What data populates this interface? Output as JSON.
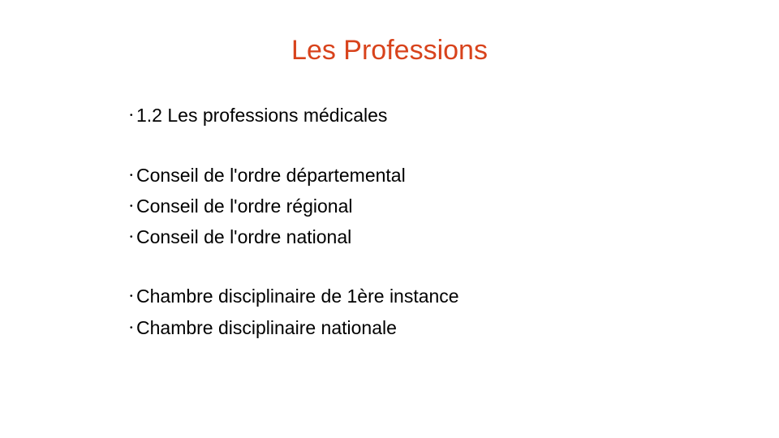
{
  "slide": {
    "title": "Les Professions",
    "title_color": "#d8431c",
    "bullet_symbol": "•",
    "bullets": [
      "1.2 Les professions médicales",
      "Conseil de l'ordre départemental",
      "Conseil de l'ordre régional",
      "Conseil de l'ordre national",
      "Chambre disciplinaire de 1ère instance",
      "Chambre disciplinaire nationale"
    ]
  }
}
